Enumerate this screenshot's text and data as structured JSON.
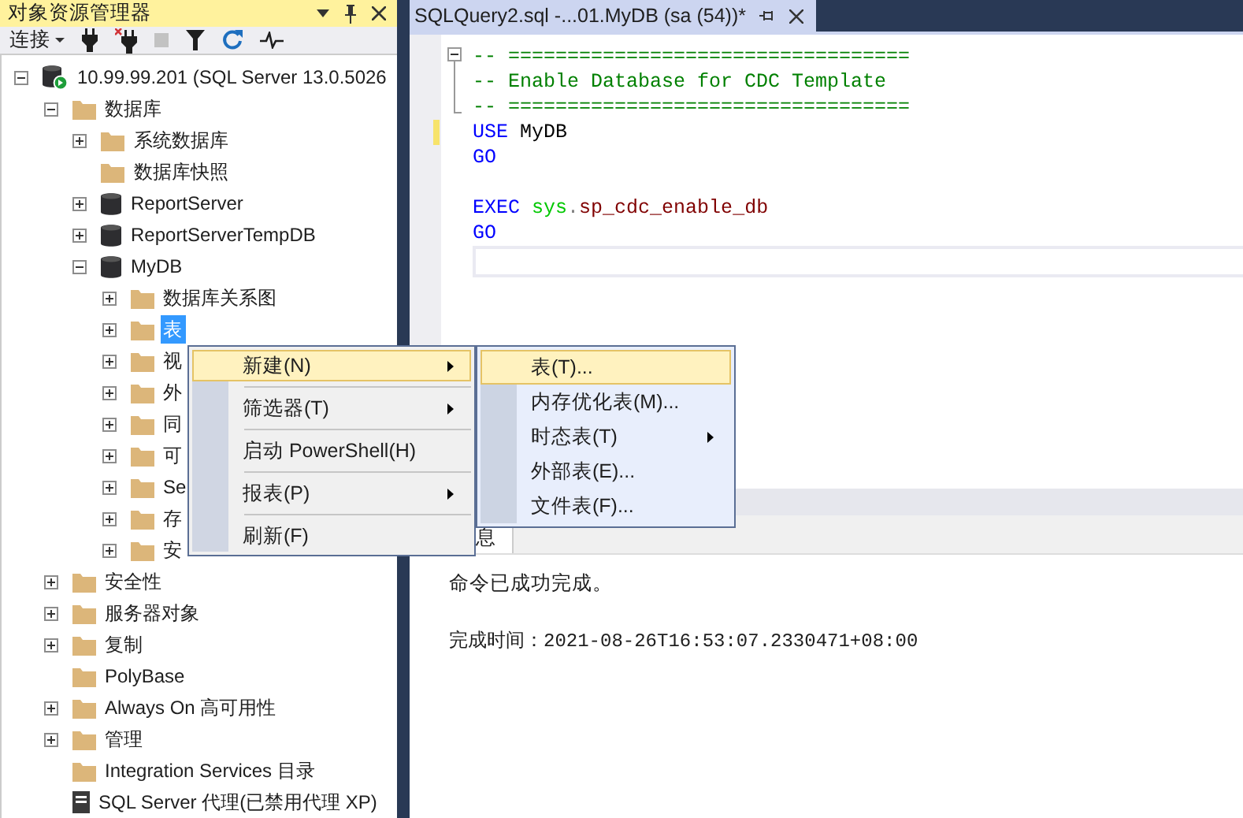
{
  "explorer": {
    "title": "对象资源管理器",
    "toolbar": {
      "connect_label": "连接"
    },
    "tree": [
      {
        "label": "10.99.99.201 (SQL Server 13.0.5026",
        "kind": "server",
        "expanded": true,
        "selected": false,
        "children": [
          {
            "label": "数据库",
            "kind": "folder",
            "expanded": true,
            "selected": false,
            "children": [
              {
                "label": "系统数据库",
                "kind": "folder",
                "expanded": false,
                "selected": false
              },
              {
                "label": "数据库快照",
                "kind": "folder",
                "selected": false
              },
              {
                "label": "ReportServer",
                "kind": "database",
                "expanded": false,
                "selected": false
              },
              {
                "label": "ReportServerTempDB",
                "kind": "database",
                "expanded": false,
                "selected": false
              },
              {
                "label": "MyDB",
                "kind": "database",
                "expanded": true,
                "selected": false,
                "children": [
                  {
                    "label": "数据库关系图",
                    "kind": "folder",
                    "expanded": false,
                    "selected": false
                  },
                  {
                    "label": "表",
                    "kind": "folder",
                    "expanded": false,
                    "selected": true
                  },
                  {
                    "label": "视",
                    "kind": "folder",
                    "expanded": false,
                    "selected": false
                  },
                  {
                    "label": "外",
                    "kind": "folder",
                    "expanded": false,
                    "selected": false
                  },
                  {
                    "label": "同",
                    "kind": "folder",
                    "expanded": false,
                    "selected": false
                  },
                  {
                    "label": "可",
                    "kind": "folder",
                    "expanded": false,
                    "selected": false
                  },
                  {
                    "label": "Se",
                    "kind": "folder",
                    "expanded": false,
                    "selected": false
                  },
                  {
                    "label": "存",
                    "kind": "folder",
                    "expanded": false,
                    "selected": false
                  },
                  {
                    "label": "安",
                    "kind": "folder",
                    "expanded": false,
                    "selected": false
                  }
                ]
              }
            ]
          },
          {
            "label": "安全性",
            "kind": "folder",
            "expanded": false,
            "selected": false
          },
          {
            "label": "服务器对象",
            "kind": "folder",
            "expanded": false,
            "selected": false
          },
          {
            "label": "复制",
            "kind": "folder",
            "expanded": false,
            "selected": false
          },
          {
            "label": "PolyBase",
            "kind": "folder",
            "selected": false
          },
          {
            "label": "Always On 高可用性",
            "kind": "folder",
            "expanded": false,
            "selected": false
          },
          {
            "label": "管理",
            "kind": "folder",
            "expanded": false,
            "selected": false
          },
          {
            "label": "Integration Services 目录",
            "kind": "folder",
            "selected": false
          },
          {
            "label": "SQL Server 代理(已禁用代理 XP)",
            "kind": "agent",
            "selected": false
          }
        ]
      }
    ]
  },
  "editor": {
    "tab": {
      "title": "SQLQuery2.sql -...01.MyDB (sa (54))*",
      "selected": true
    },
    "lines": [
      {
        "changed": false,
        "tokens": [
          {
            "kind": "comment",
            "text": "-- =================================="
          }
        ]
      },
      {
        "changed": false,
        "tokens": [
          {
            "kind": "comment",
            "text": "-- Enable Database for CDC Template"
          }
        ]
      },
      {
        "changed": false,
        "tokens": [
          {
            "kind": "comment",
            "text": "-- =================================="
          }
        ]
      },
      {
        "changed": true,
        "tokens": [
          {
            "kind": "keyword",
            "text": "USE"
          },
          {
            "kind": "plain",
            "text": " MyDB"
          }
        ]
      },
      {
        "changed": false,
        "tokens": [
          {
            "kind": "keyword",
            "text": "GO"
          }
        ]
      },
      {
        "changed": false
      },
      {
        "changed": false,
        "tokens": [
          {
            "kind": "keyword",
            "text": "EXEC "
          },
          {
            "kind": "system",
            "text": "sys"
          },
          {
            "kind": "operator",
            "text": "."
          },
          {
            "kind": "proc",
            "text": "sp_cdc_enable_db"
          }
        ]
      },
      {
        "changed": false,
        "tokens": [
          {
            "kind": "keyword",
            "text": "GO"
          }
        ]
      }
    ],
    "results": {
      "tab": "息",
      "messages": [
        "命令已成功完成。",
        "完成时间：2021-08-26T16:53:07.2330471+08:00"
      ]
    }
  },
  "context_menu": {
    "items": [
      {
        "kind": "item",
        "label": "新建(N)",
        "submenu": true,
        "selected": true
      },
      {
        "kind": "separator"
      },
      {
        "kind": "item",
        "label": "筛选器(T)",
        "submenu": true,
        "selected": false
      },
      {
        "kind": "separator"
      },
      {
        "kind": "item",
        "label": "启动 PowerShell(H)",
        "submenu": false,
        "selected": false
      },
      {
        "kind": "separator"
      },
      {
        "kind": "item",
        "label": "报表(P)",
        "submenu": true,
        "selected": false
      },
      {
        "kind": "separator"
      },
      {
        "kind": "item",
        "label": "刷新(F)",
        "submenu": false,
        "selected": false
      }
    ]
  },
  "submenu": {
    "items": [
      {
        "kind": "item",
        "label": "表(T)...",
        "submenu": false,
        "selected": true
      },
      {
        "kind": "item",
        "label": "内存优化表(M)...",
        "submenu": false,
        "selected": false
      },
      {
        "kind": "item",
        "label": "时态表(T)",
        "submenu": true,
        "selected": false
      },
      {
        "kind": "item",
        "label": "外部表(E)...",
        "submenu": false,
        "selected": false
      },
      {
        "kind": "item",
        "label": "文件表(F)...",
        "submenu": false,
        "selected": false
      }
    ]
  }
}
